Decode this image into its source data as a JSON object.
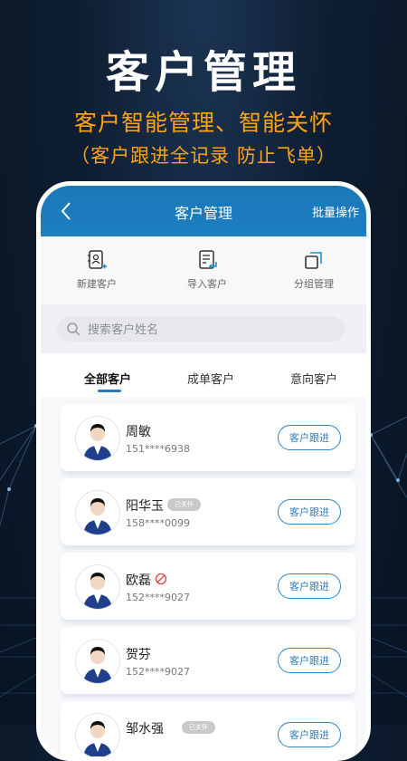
{
  "promo": {
    "title": "客户管理",
    "subtitle": "客户智能管理、智能关怀",
    "subtitle2": "（客户跟进全记录  防止飞单）"
  },
  "appbar": {
    "back_icon": "chevron-left-icon",
    "title": "客户管理",
    "batch_label": "批量操作"
  },
  "quick_actions": [
    {
      "label": "新建客户",
      "icon": "add-contact-icon"
    },
    {
      "label": "导入客户",
      "icon": "import-doc-icon"
    },
    {
      "label": "分组管理",
      "icon": "group-icon"
    }
  ],
  "search": {
    "placeholder": "搜索客户姓名",
    "icon": "search-icon"
  },
  "tabs": [
    {
      "label": "全部客户",
      "active": true
    },
    {
      "label": "成单客户",
      "active": false
    },
    {
      "label": "意向客户",
      "active": false
    }
  ],
  "customers": [
    {
      "name": "周敏",
      "phone": "151****6938",
      "badge": "",
      "action": "客户跟进"
    },
    {
      "name": "阳华玉",
      "phone": "158****0099",
      "badge": "已关怀",
      "action": "客户跟进"
    },
    {
      "name": "欧磊",
      "phone": "152****9027",
      "badge": "",
      "mark": "no-entry-icon",
      "action": "客户跟进"
    },
    {
      "name": "贺芬",
      "phone": "152****9027",
      "badge": "",
      "action": "客户跟进"
    },
    {
      "name": "邹水强",
      "phone": "",
      "badge": "已关怀",
      "action": "客户跟进"
    }
  ],
  "colors": {
    "brand": "#1d7ec0",
    "accent": "#ffa21a"
  }
}
